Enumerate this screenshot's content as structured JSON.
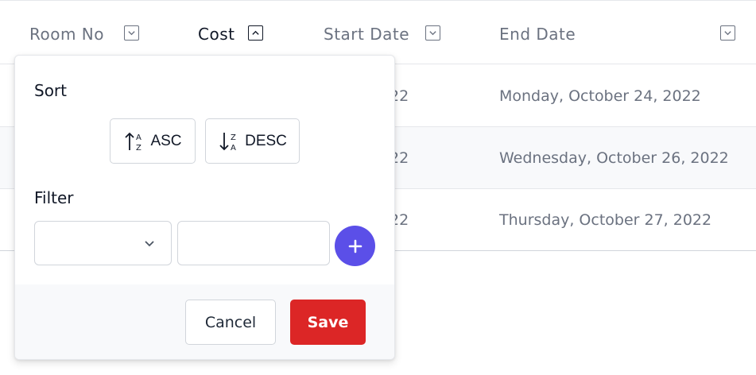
{
  "table": {
    "columns": [
      {
        "label": "Room No",
        "sort_icon": "chevron-down-icon",
        "active": false
      },
      {
        "label": "Cost",
        "sort_icon": "chevron-up-icon",
        "active": true
      },
      {
        "label": "Start Date",
        "sort_icon": "chevron-down-icon",
        "active": false
      },
      {
        "label": "End Date",
        "sort_icon": "chevron-down-icon",
        "active": false
      }
    ],
    "rows": [
      {
        "start_date_partial": "22",
        "end_date": "Monday, October 24, 2022"
      },
      {
        "start_date_partial": "22",
        "end_date": "Wednesday, October 26, 2022"
      },
      {
        "start_date_partial": "22",
        "end_date": "Thursday, October 27, 2022"
      }
    ]
  },
  "popover": {
    "sort_title": "Sort",
    "asc_label": "ASC",
    "asc_icon": "sort-asc-icon",
    "desc_label": "DESC",
    "desc_icon": "sort-desc-icon",
    "filter_title": "Filter",
    "filter_operator_value": "",
    "filter_value": "",
    "add_icon": "plus-icon",
    "cancel_label": "Cancel",
    "save_label": "Save"
  },
  "colors": {
    "primary": "#5b4fe8",
    "danger": "#dc2626",
    "row_alt": "#f8f9fb",
    "muted_text": "#6b7280"
  }
}
